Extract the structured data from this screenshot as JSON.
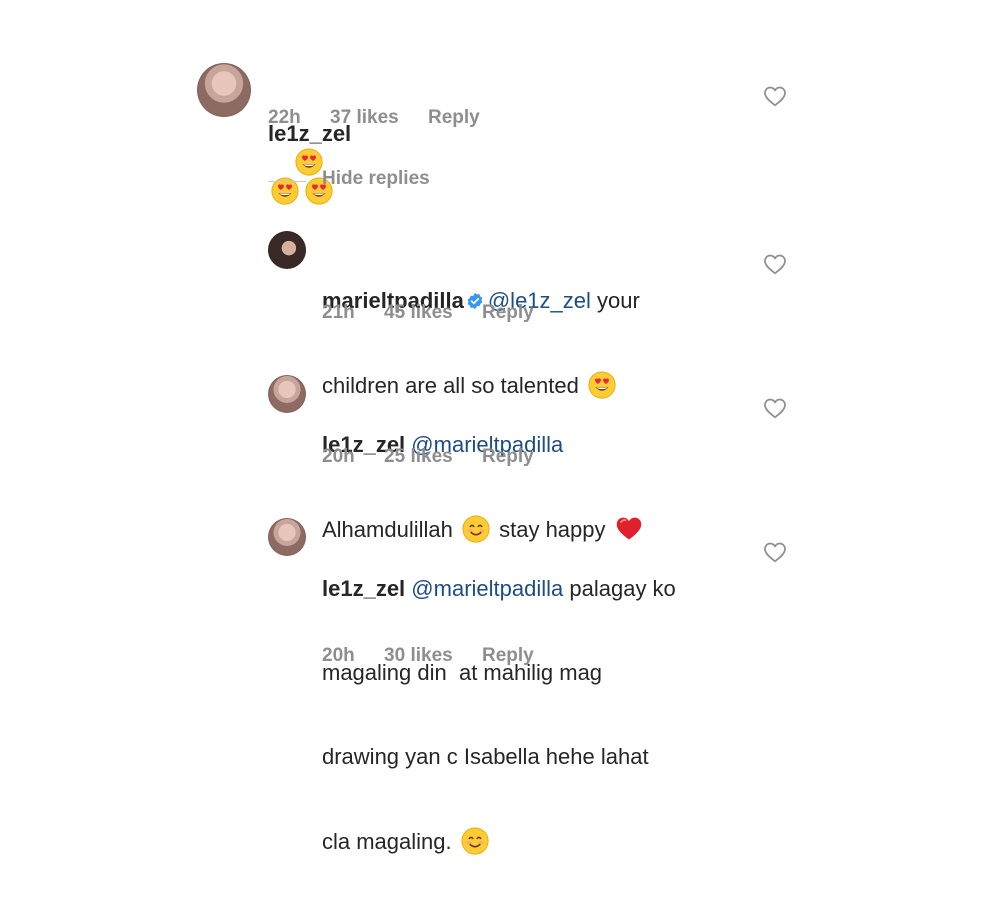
{
  "comments": [
    {
      "username": "le1z_zel",
      "emoji_text": "😍😍😍",
      "time": "22h",
      "likes": "37 likes",
      "reply": "Reply"
    },
    {
      "username": "marieltpadilla",
      "mention": "@le1z_zel",
      "text_1": "your",
      "text_2": "children are all so talented",
      "time": "21h",
      "likes": "45 likes",
      "reply": "Reply"
    },
    {
      "username": "le1z_zel",
      "mention": "@marieltpadilla",
      "text_1": "Alhamdulillah",
      "text_2": "stay happy",
      "time": "20h",
      "likes": "25 likes",
      "reply": "Reply"
    },
    {
      "username": "le1z_zel",
      "mention": "@marieltpadilla",
      "line_1": "palagay ko",
      "line_2": "magaling din  at mahilig mag",
      "line_3": "drawing yan c Isabella hehe lahat",
      "line_4": "cla magaling.",
      "time": "20h",
      "likes": "30 likes",
      "reply": "Reply"
    }
  ],
  "hide_replies": "Hide replies",
  "colors": {
    "text": "#262626",
    "meta": "#8e8e8e",
    "mention": "#1e4d84",
    "verified": "#3897f0",
    "heart_red": "#e0202c"
  },
  "icons": [
    "heart-outline-icon",
    "verified-badge-icon",
    "heart-eyes-emoji",
    "smiling-emoji",
    "red-heart-emoji"
  ]
}
